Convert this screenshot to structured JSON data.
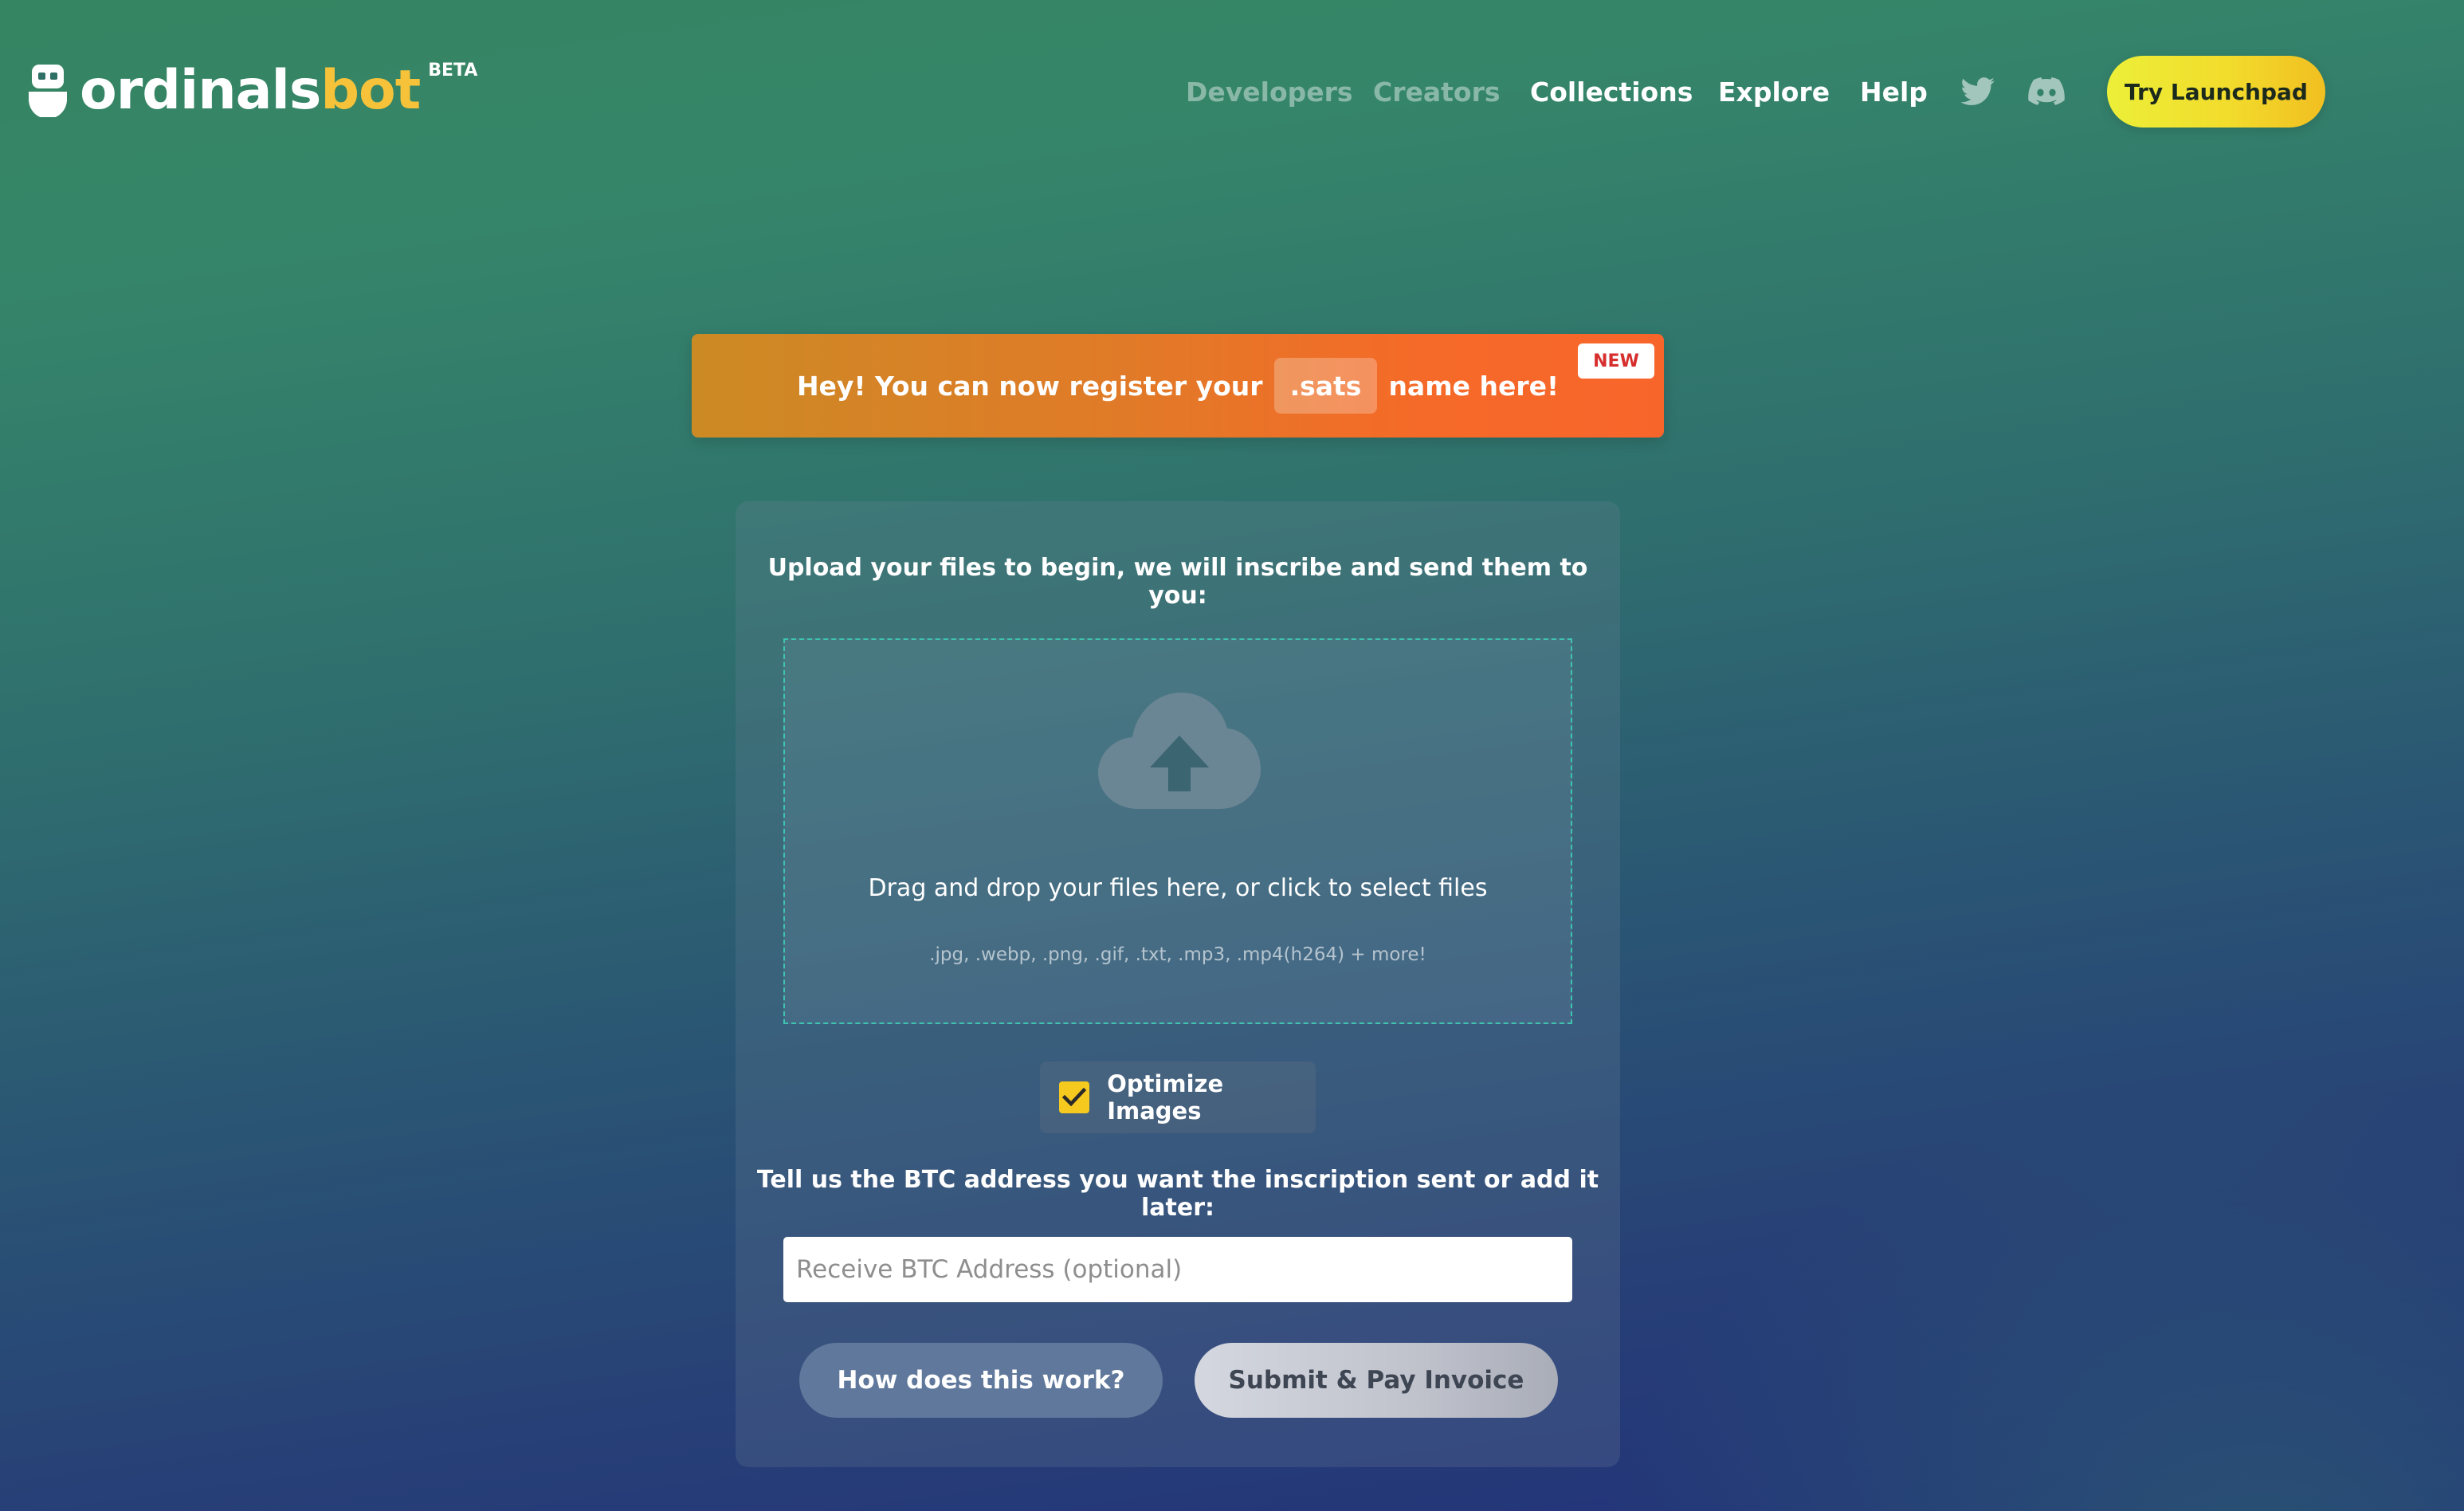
{
  "brand": {
    "name_part1": "ordinals",
    "name_part2": "bot",
    "beta": "BETA",
    "accent_color": "#f6c23a"
  },
  "nav": {
    "links": [
      {
        "label": "Developers",
        "state": "dim"
      },
      {
        "label": "Creators",
        "state": "dim"
      },
      {
        "label": "Collections",
        "state": "bright"
      },
      {
        "label": "Explore",
        "state": "bright"
      },
      {
        "label": "Help",
        "state": "bright"
      }
    ],
    "social_icons": [
      "twitter-icon",
      "discord-icon"
    ],
    "cta_label": "Try Launchpad"
  },
  "banner": {
    "text_before": "Hey! You can now register your",
    "highlight": ".sats",
    "text_after": "name here!",
    "badge": "NEW"
  },
  "upload": {
    "title": "Upload your files to begin, we will inscribe and send them to you:",
    "icon": "cloud-upload-icon",
    "drop_text": "Drag and drop your files here, or click to select files",
    "formats": ".jpg, .webp, .png, .gif, .txt, .mp3, .mp4(h264) + more!",
    "optimize_label": "Optimize Images",
    "optimize_checked": true,
    "btc_label": "Tell us the BTC address you want the inscription sent or add it later:",
    "btc_placeholder": "Receive BTC Address (optional)",
    "btc_value": "",
    "how_button": "How does this work?",
    "submit_button": "Submit & Pay Invoice"
  }
}
